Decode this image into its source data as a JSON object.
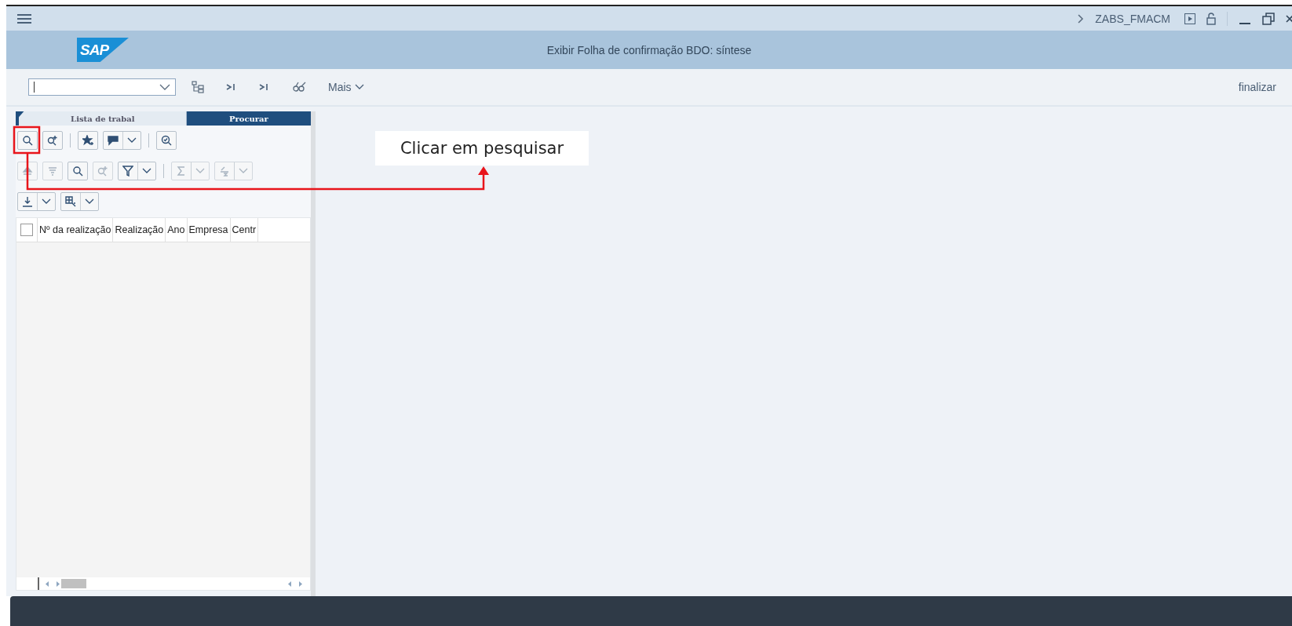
{
  "title_bar": {
    "transaction_code": "ZABS_FMACM"
  },
  "header": {
    "logo_text": "SAP",
    "title": "Exibir Folha de confirmação BDO: síntese"
  },
  "toolbar": {
    "more_label": "Mais",
    "exit_label": "finalizar"
  },
  "tabs": [
    {
      "label": "Lista de trabal",
      "selected": false
    },
    {
      "label": "Procurar",
      "selected": true
    }
  ],
  "panel_toolbars": [
    [
      {
        "kind": "search",
        "disabled": false
      },
      {
        "kind": "search-plus",
        "disabled": false
      },
      {
        "kind": "separator"
      },
      {
        "kind": "star",
        "disabled": false
      },
      {
        "kind": "layout",
        "dropdown": true,
        "disabled": false
      },
      {
        "kind": "separator"
      },
      {
        "kind": "zoom-check",
        "disabled": false
      }
    ],
    [
      {
        "kind": "sort-up",
        "disabled": true
      },
      {
        "kind": "sort-down",
        "disabled": true
      },
      {
        "kind": "search",
        "disabled": false
      },
      {
        "kind": "search-plus",
        "disabled": true
      },
      {
        "kind": "filter",
        "dropdown": true,
        "disabled": false
      },
      {
        "kind": "separator"
      },
      {
        "kind": "sum",
        "dropdown": true,
        "disabled": true
      },
      {
        "kind": "subtotal",
        "dropdown": true,
        "disabled": true
      }
    ],
    [
      {
        "kind": "export",
        "dropdown": true,
        "disabled": false
      },
      {
        "kind": "grid",
        "dropdown": true,
        "disabled": false
      }
    ]
  ],
  "table": {
    "select_all_checked": false,
    "columns": [
      "Nº da realização",
      "Realização",
      "Ano",
      "Empresa",
      "Centr"
    ]
  },
  "annotation": {
    "text": "Clicar em pesquisar"
  }
}
